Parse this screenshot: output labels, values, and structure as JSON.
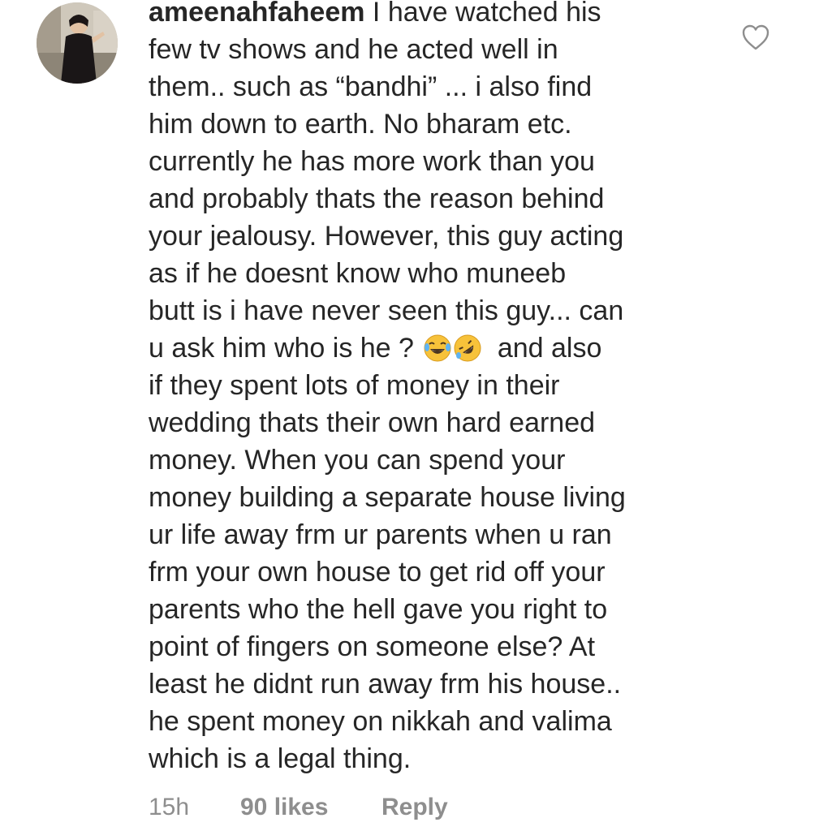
{
  "comment": {
    "username": "ameenahfaheem",
    "lines": [
      "I have watched his",
      "few tv shows and he acted well in",
      "them.. such as “bandhi” ... i also find",
      "him down to earth. No bharam etc.",
      "currently he has more work than you",
      "and probably thats the reason behind",
      "your jealousy. However, this guy acting",
      "as if he doesnt know who muneeb",
      "butt is i have never seen this guy... can",
      "u ask him who is he ?",
      "and also",
      "if they spent lots of money in their",
      "wedding thats their own hard earned",
      "money. When you can spend your",
      "money building a separate house living",
      "ur life away frm ur parents when u ran",
      "frm your own house to get rid off your",
      "parents who the hell gave you right to",
      "point of fingers on someone else?  At",
      "least he didnt run away frm his house..",
      "he spent money on nikkah and valima",
      "which is a legal thing."
    ],
    "emojis": [
      "face-with-tears-of-joy-icon",
      "rolling-on-floor-laughing-icon"
    ]
  },
  "footer": {
    "timestamp": "15h",
    "likes": "90 likes",
    "reply": "Reply"
  },
  "colors": {
    "text": "#262626",
    "muted": "#8e8e8e",
    "emoji_yellow": "#f7c23a"
  }
}
